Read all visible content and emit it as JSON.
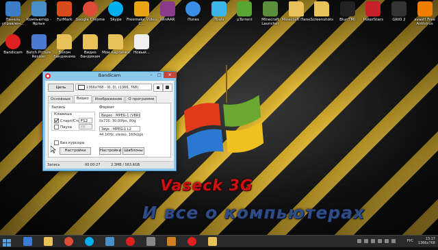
{
  "desktop_icons": [
    {
      "label": "Панель управлен...",
      "icon": "control-panel-icon",
      "color": "#3c7dc8"
    },
    {
      "label": "Компьютер - Ярлык",
      "icon": "computer-icon",
      "color": "#4a90c8"
    },
    {
      "label": "FurMark",
      "icon": "furmark-icon",
      "color": "#d94b1a"
    },
    {
      "label": "Google Chrome",
      "icon": "chrome-icon",
      "color": "#dd4b39"
    },
    {
      "label": "Skype",
      "icon": "skype-icon",
      "color": "#00aff0"
    },
    {
      "label": "Freemake Video C...",
      "icon": "freemake-icon",
      "color": "#e8a417"
    },
    {
      "label": "WinRAR",
      "icon": "winrar-icon",
      "color": "#8a3a8a"
    },
    {
      "label": "iTunes",
      "icon": "itunes-icon",
      "color": "#3a8ee6"
    },
    {
      "label": "iTools",
      "icon": "itools-icon",
      "color": "#3cb4e6"
    },
    {
      "label": "µTorrent",
      "icon": "utorrent-icon",
      "color": "#58a533"
    },
    {
      "label": "Minecraft Launcher",
      "icon": "minecraft-icon",
      "color": "#5b8f3b"
    },
    {
      "label": "Minecraft Папк",
      "icon": "folder-icon",
      "color": "#e8c15a"
    },
    {
      "label": "Screenshots",
      "icon": "folder-icon",
      "color": "#e8c15a"
    },
    {
      "label": "Blur(TM)",
      "icon": "blur-icon",
      "color": "#222222"
    },
    {
      "label": "PokerStars",
      "icon": "pokerstars-icon",
      "color": "#c8202a"
    },
    {
      "label": "GRID 2",
      "icon": "grid2-icon",
      "color": "#333333"
    },
    {
      "label": "avast! Free Antivirus",
      "icon": "avast-icon",
      "color": "#f07d00"
    },
    {
      "label": "Bandicam",
      "icon": "bandicam-icon",
      "color": "#e02020"
    },
    {
      "label": "Batch Picture Resizer",
      "icon": "batch-resizer-icon",
      "color": "#4a7bd0"
    },
    {
      "label": "Взлом бандикама",
      "icon": "folder-icon",
      "color": "#e8c15a"
    },
    {
      "label": "Видео бандикам",
      "icon": "folder-icon",
      "color": "#e8c15a"
    },
    {
      "label": "Мои картинки",
      "icon": "folder-icon",
      "color": "#e8c15a"
    },
    {
      "label": "Новый...",
      "icon": "document-icon",
      "color": "#f0f0f0"
    }
  ],
  "window": {
    "title": "Bandicam",
    "target_button": "Цель",
    "region": "1366x768 - (0, 0), (1366, 768)",
    "tabs": [
      "Основные",
      "Видео",
      "Изображение",
      "О программе"
    ],
    "active_tab": "Видео",
    "record_group": "Запись",
    "hotkey_group": "Клавиша",
    "start_stop_label": "Старт/Стоп",
    "start_stop_key": "F12",
    "pause_label": "Пауза",
    "pause_key": "F8",
    "no_cursor_label": "Без курсора",
    "settings_button": "Настройки",
    "format_group": "Формат",
    "video_format": "Видео : MPEG-1 (VBR)",
    "video_details": "0x720, 30.00fps, 80q",
    "audio_format": "Звук : MPEG-1 L2",
    "audio_details": "44.1KHz, stereo, 160kbps",
    "format_settings_button": "Настройки",
    "templates_button": "Шаблоны",
    "status_label": "Запись",
    "status_time": "00:00:27",
    "status_size": "2.3MB / 563.6GB"
  },
  "wallpaper": {
    "brand": "Vaseck 3G",
    "tagline": "И все о компьютерах",
    "brand_color": "#cc1111",
    "tagline_color": "#2f4c86"
  },
  "taskbar": {
    "items": [
      {
        "icon": "ie-icon",
        "color": "#3a7bd5"
      },
      {
        "icon": "explorer-icon",
        "color": "#e8c15a"
      },
      {
        "icon": "chrome-icon",
        "color": "#dd4b39"
      },
      {
        "icon": "skype-icon",
        "color": "#00aff0"
      },
      {
        "icon": "media-icon",
        "color": "#4a90c8"
      },
      {
        "icon": "bandicam-icon",
        "color": "#e02020"
      },
      {
        "icon": "app-icon",
        "color": "#888888"
      },
      {
        "icon": "video-icon",
        "color": "#d08020"
      },
      {
        "icon": "bandicam-record-icon",
        "color": "#e02020"
      },
      {
        "icon": "folder-icon",
        "color": "#e8c15a"
      }
    ],
    "lang": "РУС",
    "time": "13:17",
    "date": "1366x768"
  }
}
